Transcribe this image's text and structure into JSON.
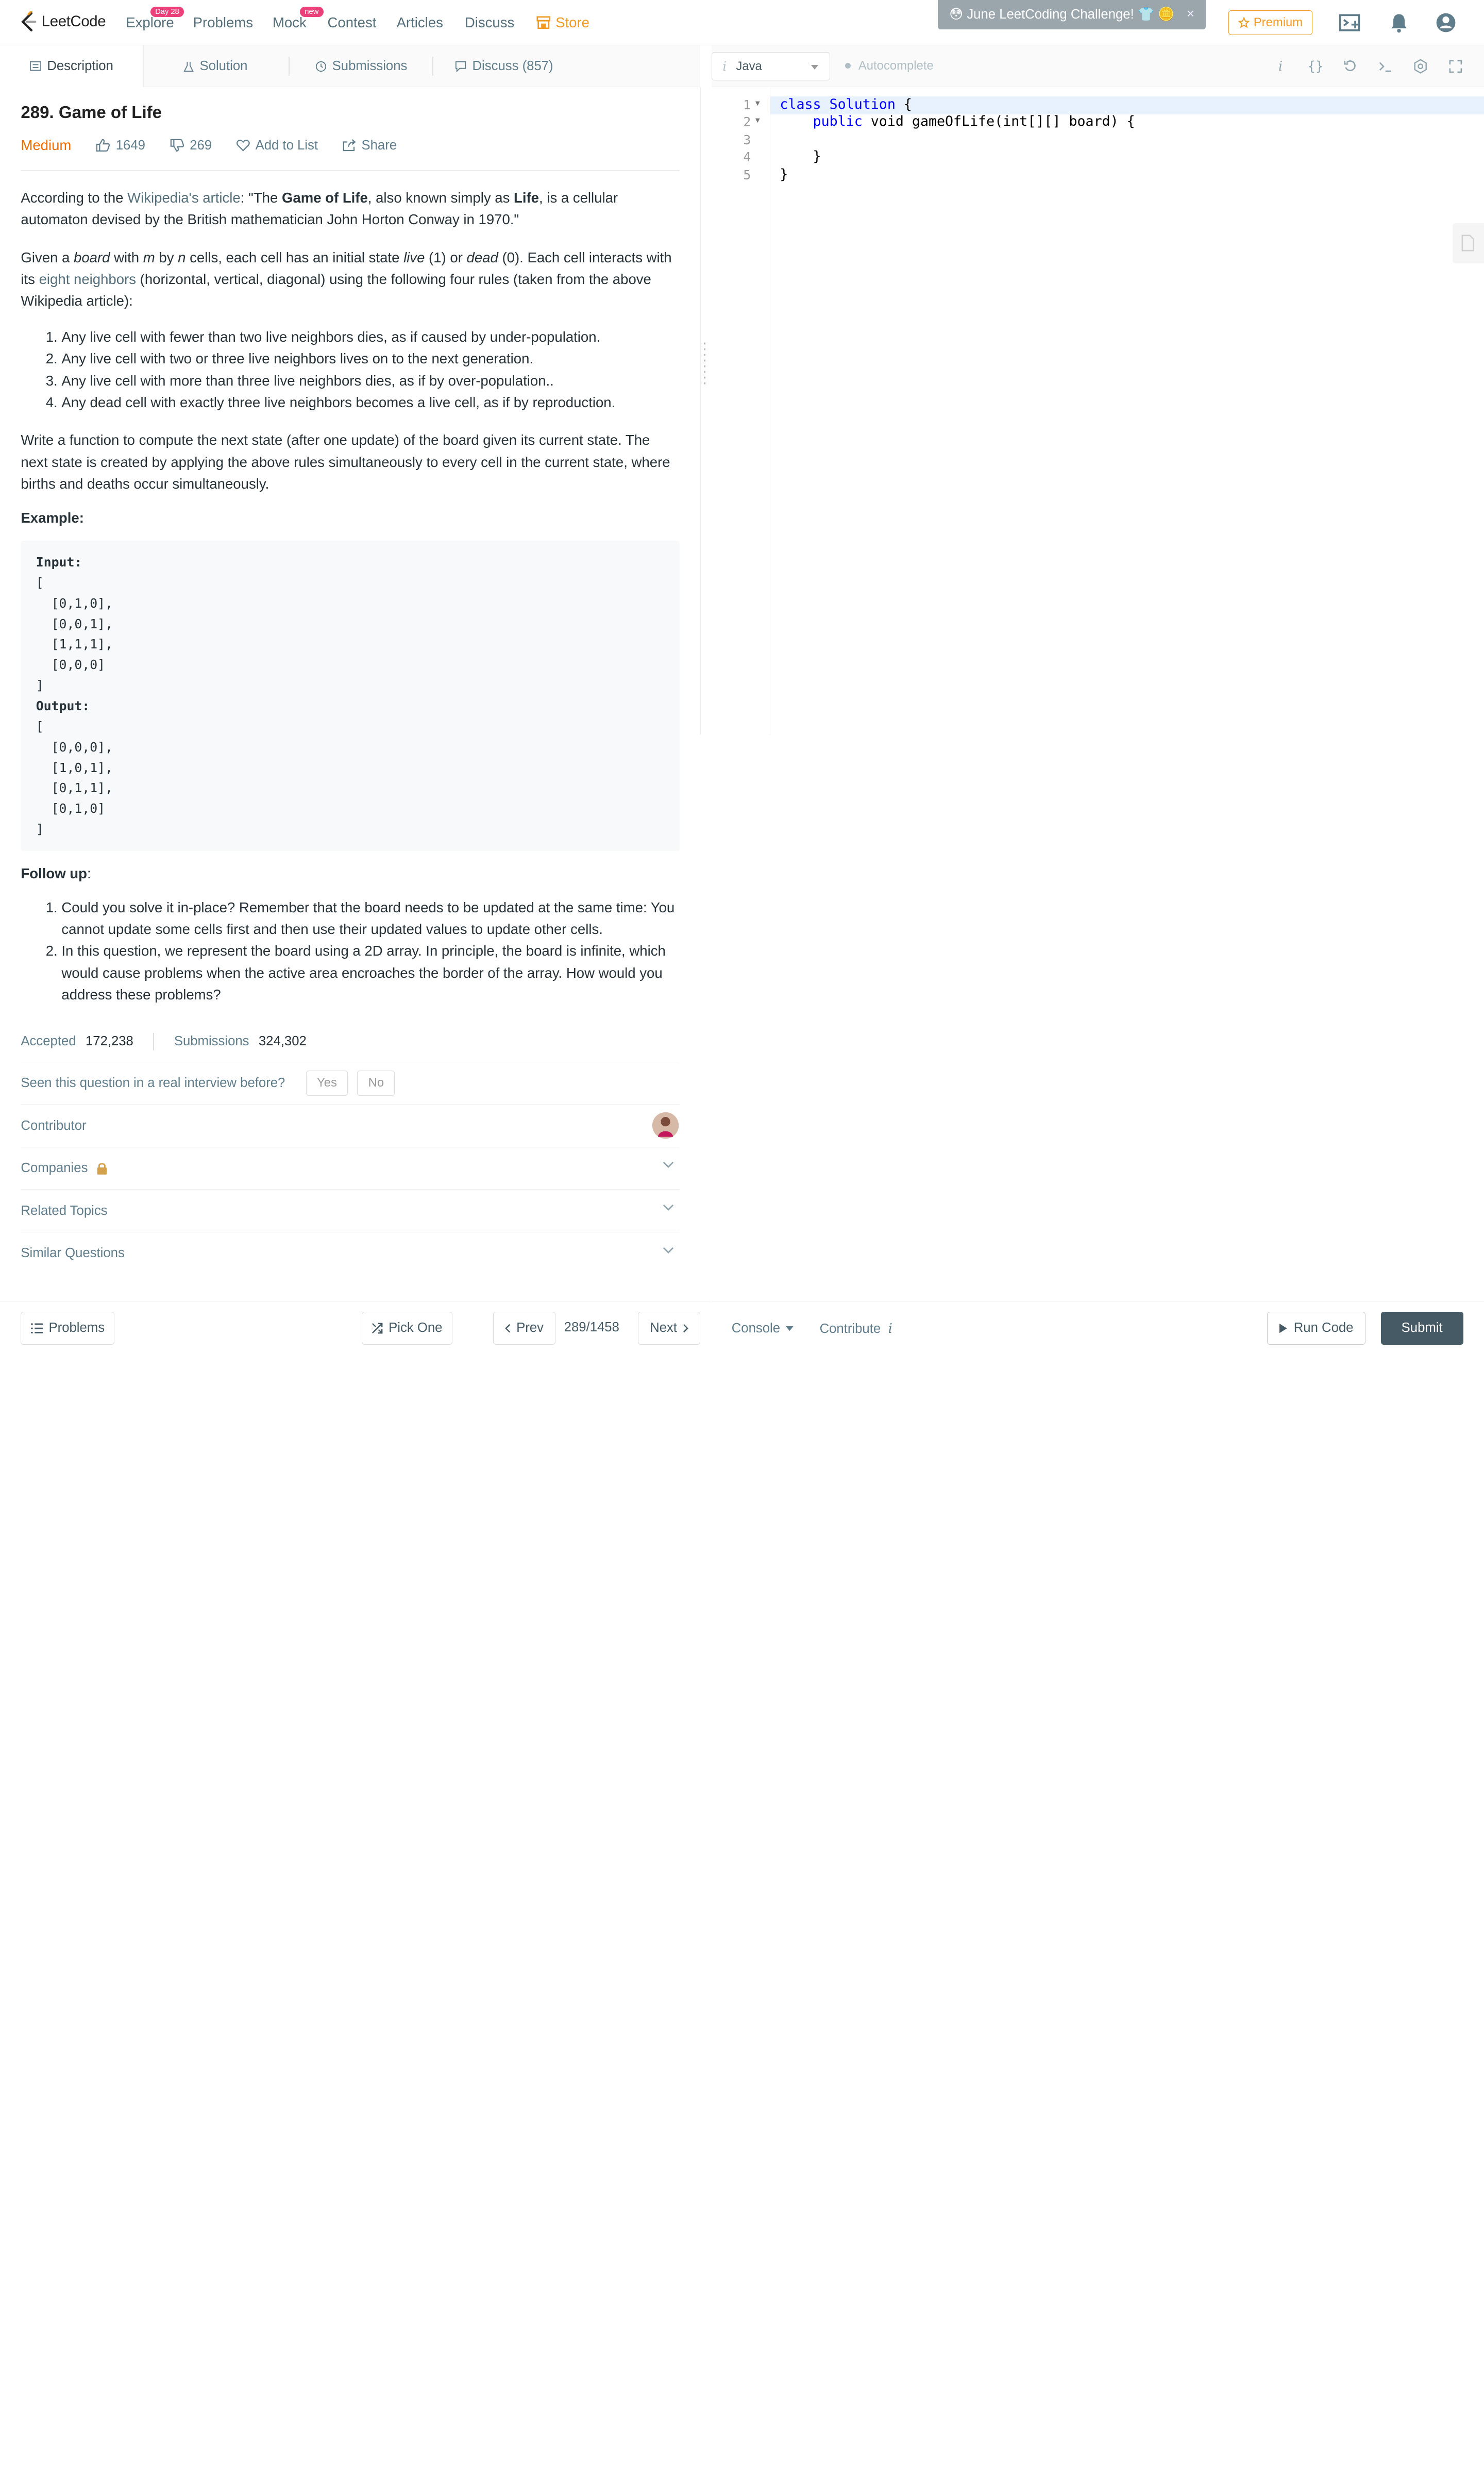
{
  "nav": {
    "logo_text": "LeetCode",
    "items": {
      "explore": "Explore",
      "explore_badge": "Day 28",
      "problems": "Problems",
      "mock": "Mock",
      "mock_badge": "new",
      "contest": "Contest",
      "articles": "Articles",
      "discuss": "Discuss",
      "store": "Store"
    },
    "banner": "June LeetCoding Challenge!",
    "banner_close": "×",
    "premium": "Premium"
  },
  "tabs": {
    "description": "Description",
    "solution": "Solution",
    "submissions": "Submissions",
    "discuss": "Discuss (857)"
  },
  "problem": {
    "title": "289. Game of Life",
    "difficulty": "Medium",
    "likes": "1649",
    "dislikes": "269",
    "add_to_list": "Add to List",
    "share": "Share",
    "p1_pre": "According to the ",
    "p1_link": "Wikipedia's article",
    "p1_mid": ": \"The ",
    "p1_b1": "Game of Life",
    "p1_mid2": ", also known simply as ",
    "p1_b2": "Life",
    "p1_post": ", is a cellular automaton devised by the British mathematician John Horton Conway in 1970.\"",
    "p2_a": "Given a ",
    "p2_board": "board",
    "p2_b": " with ",
    "p2_m": "m",
    "p2_c": " by ",
    "p2_n": "n",
    "p2_d": " cells, each cell has an initial state ",
    "p2_live": "live",
    "p2_e": " (1) or ",
    "p2_dead": "dead",
    "p2_f": " (0). Each cell interacts with its ",
    "p2_link": "eight neighbors",
    "p2_g": " (horizontal, vertical, diagonal) using the following four rules (taken from the above Wikipedia article):",
    "rules": [
      "Any live cell with fewer than two live neighbors dies, as if caused by under-population.",
      "Any live cell with two or three live neighbors lives on to the next generation.",
      "Any live cell with more than three live neighbors dies, as if by over-population..",
      "Any dead cell with exactly three live neighbors becomes a live cell, as if by reproduction."
    ],
    "p3": "Write a function to compute the next state (after one update) of the board given its current state. The next state is created by applying the above rules simultaneously to every cell in the current state, where births and deaths occur simultaneously.",
    "example_label": "Example:",
    "input_label": "Input:",
    "input_body": "[\n  [0,1,0],\n  [0,0,1],\n  [1,1,1],\n  [0,0,0]\n]",
    "output_label": "Output:",
    "output_body": "[\n  [0,0,0],\n  [1,0,1],\n  [0,1,1],\n  [0,1,0]\n]",
    "follow_label": "Follow up",
    "follow_colon": ":",
    "follow_items": [
      "Could you solve it in-place? Remember that the board needs to be updated at the same time: You cannot update some cells first and then use their updated values to update other cells.",
      "In this question, we represent the board using a 2D array. In principle, the board is infinite, which would cause problems when the active area encroaches the border of the array. How would you address these problems?"
    ],
    "accepted_label": "Accepted",
    "accepted": "172,238",
    "submissions_label": "Submissions",
    "submissions": "324,302",
    "interview_q": "Seen this question in a real interview before?",
    "yes": "Yes",
    "no": "No",
    "contributor": "Contributor",
    "companies": "Companies",
    "related": "Related Topics",
    "similar": "Similar Questions"
  },
  "bottom_left": {
    "problems": "Problems",
    "pick_one": "Pick One",
    "prev": "Prev",
    "page": "289/1458",
    "next": "Next"
  },
  "editor": {
    "language": "Java",
    "autocomplete": "Autocomplete",
    "line_numbers": [
      "1",
      "2",
      "3",
      "4",
      "5"
    ],
    "line1_kw": "class",
    "line1_cls": "Solution",
    "line1_rest": " {",
    "line2_kw": "public",
    "line2_rest": " void gameOfLife(int[][] board) {",
    "line4": "    }",
    "line5": "}"
  },
  "bottom_right": {
    "console": "Console",
    "contribute": "Contribute",
    "run_code": "Run Code",
    "submit": "Submit"
  },
  "colors": {
    "accent_orange": "#ef6c00",
    "store_orange": "#f09b26",
    "submit_bg": "#455a64",
    "badge_pink": "#ec407a"
  }
}
